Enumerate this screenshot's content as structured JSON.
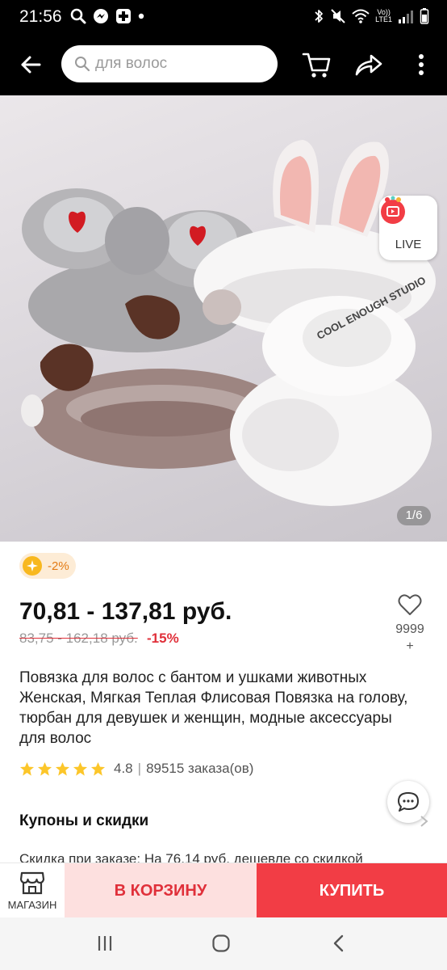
{
  "status_bar": {
    "time": "21:56",
    "volte_top": "Vo))",
    "volte_bottom": "LTE1",
    "icons": [
      "search-icon",
      "messenger-icon",
      "app-icon",
      "dot-icon",
      "bluetooth-icon",
      "mute-icon",
      "wifi-icon",
      "signal-icon",
      "battery-icon"
    ]
  },
  "top_bar": {
    "back_icon": "arrow-left-icon",
    "search_placeholder": "для волос",
    "cart_icon": "cart-icon",
    "share_icon": "share-icon",
    "more_icon": "more-vertical-icon"
  },
  "gallery": {
    "counter": "1/6",
    "live_label": "LIVE",
    "printed_text": "COOL ENOUGH STUDIO"
  },
  "product": {
    "discount_badge": "-2%",
    "price": "70,81 - 137,81 руб.",
    "old_price": "83,75 - 162,18 руб.",
    "old_discount": "-15%",
    "wishlist_count": "9999",
    "wishlist_plus": "+",
    "title": "Повязка для волос с бантом и ушками животных Женская, Мягкая Теплая Флисовая Повязка на голову, тюрбан для девушек и женщин, модные аксессуары для волос",
    "rating": 4.8,
    "rating_text": "4.8",
    "rating_separator": "|",
    "orders": "89515 заказа(ов)"
  },
  "coupons": {
    "title": "Купоны и скидки",
    "text": "Скидка при заказе: На 76,14 руб. дешевле со скидкой"
  },
  "action_bar": {
    "store_label": "МАГАЗИН",
    "add_to_cart": "В КОРЗИНУ",
    "buy": "КУПИТЬ"
  },
  "colors": {
    "accent_red": "#f23d45",
    "cart_button_bg": "#fde0df",
    "discount_orange": "#e37b14",
    "star_yellow": "#fcc62a"
  }
}
